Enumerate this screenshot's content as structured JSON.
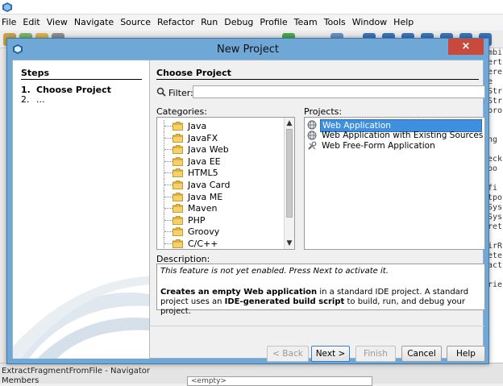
{
  "ide": {
    "menu": [
      "File",
      "Edit",
      "View",
      "Navigate",
      "Source",
      "Refactor",
      "Run",
      "Debug",
      "Profile",
      "Team",
      "Tools",
      "Window",
      "Help"
    ],
    "code_lines": [
      "mbi",
      "ert",
      "ere",
      "e",
      "Str",
      "Str",
      "pro",
      "",
      "",
      "ng",
      "",
      "eck",
      " po",
      "",
      " fi",
      "tpo",
      "Sys",
      "Sys",
      "ret",
      "",
      "irR",
      "ete",
      "act",
      "",
      "rie"
    ],
    "navigator_title": "ExtractFragmentFromFile - Navigator",
    "members_label": "Members",
    "combo_value": "<empty>"
  },
  "dialog": {
    "title": "New Project",
    "close_label": "×",
    "steps": {
      "title": "Steps",
      "items": [
        {
          "num": "1.",
          "label": "Choose Project"
        },
        {
          "num": "2.",
          "label": "..."
        }
      ]
    },
    "main_title": "Choose Project",
    "filter_label": "Filter:",
    "filter_value": "",
    "categories_label": "Categories:",
    "projects_label": "Projects:",
    "categories": [
      "Java",
      "JavaFX",
      "Java Web",
      "Java EE",
      "HTML5",
      "Java Card",
      "Java ME",
      "Maven",
      "PHP",
      "Groovy",
      "C/C++"
    ],
    "selected_category": "Java Web",
    "projects": [
      "Web Application",
      "Web Application with Existing Sources",
      "Web Free-Form Application"
    ],
    "selected_project": "Web Application",
    "description_label": "Description:",
    "description_note": "This feature is not yet enabled. Press Next to activate it.",
    "description": {
      "p1_bold": "Creates an empty Web application",
      "p1_rest": " in a standard IDE project. A standard project uses an ",
      "p2_bold": "IDE-generated build script",
      "p2_rest": " to build, run, and debug your project."
    },
    "buttons": {
      "back": "< Back",
      "next": "Next >",
      "finish": "Finish",
      "cancel": "Cancel",
      "help": "Help"
    }
  }
}
